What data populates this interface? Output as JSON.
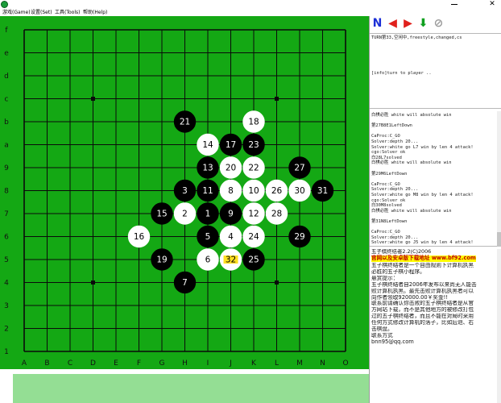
{
  "menu": {
    "items": [
      {
        "label": "游戏(Game)"
      },
      {
        "label": "设置(Set)"
      },
      {
        "label": "工具(Tools)"
      },
      {
        "label": "帮助(Help)"
      }
    ]
  },
  "window": {
    "close_glyph": "✕"
  },
  "board": {
    "size": 15,
    "row_labels": [
      "f",
      "e",
      "d",
      "c",
      "b",
      "a",
      "9",
      "8",
      "7",
      "6",
      "5",
      "4",
      "3",
      "2",
      "1"
    ],
    "col_labels": [
      "A",
      "B",
      "C",
      "D",
      "E",
      "F",
      "G",
      "H",
      "I",
      "J",
      "K",
      "L",
      "M",
      "N",
      "O"
    ],
    "colors": {
      "board": "#14a814",
      "grid": "#0a0a0a",
      "black_stone": "#000000",
      "white_stone": "#ffffff",
      "last_move": "#ffe020",
      "last_move_text": "#000000"
    },
    "stones": [
      {
        "n": "1",
        "col": "I",
        "row": "7",
        "color": "black"
      },
      {
        "n": "2",
        "col": "H",
        "row": "7",
        "color": "white"
      },
      {
        "n": "3",
        "col": "H",
        "row": "8",
        "color": "black"
      },
      {
        "n": "4",
        "col": "J",
        "row": "6",
        "color": "white"
      },
      {
        "n": "5",
        "col": "I",
        "row": "6",
        "color": "black"
      },
      {
        "n": "6",
        "col": "I",
        "row": "5",
        "color": "white"
      },
      {
        "n": "7",
        "col": "H",
        "row": "4",
        "color": "black"
      },
      {
        "n": "8",
        "col": "J",
        "row": "8",
        "color": "white"
      },
      {
        "n": "9",
        "col": "J",
        "row": "7",
        "color": "black"
      },
      {
        "n": "10",
        "col": "K",
        "row": "8",
        "color": "white"
      },
      {
        "n": "11",
        "col": "I",
        "row": "8",
        "color": "black"
      },
      {
        "n": "12",
        "col": "K",
        "row": "7",
        "color": "white"
      },
      {
        "n": "13",
        "col": "I",
        "row": "9",
        "color": "black"
      },
      {
        "n": "14",
        "col": "I",
        "row": "a",
        "color": "white"
      },
      {
        "n": "15",
        "col": "G",
        "row": "7",
        "color": "black"
      },
      {
        "n": "16",
        "col": "F",
        "row": "6",
        "color": "white"
      },
      {
        "n": "17",
        "col": "J",
        "row": "a",
        "color": "black"
      },
      {
        "n": "18",
        "col": "K",
        "row": "b",
        "color": "white"
      },
      {
        "n": "19",
        "col": "G",
        "row": "5",
        "color": "black"
      },
      {
        "n": "20",
        "col": "J",
        "row": "9",
        "color": "white"
      },
      {
        "n": "21",
        "col": "H",
        "row": "b",
        "color": "black"
      },
      {
        "n": "22",
        "col": "K",
        "row": "9",
        "color": "white"
      },
      {
        "n": "23",
        "col": "K",
        "row": "a",
        "color": "black"
      },
      {
        "n": "24",
        "col": "K",
        "row": "6",
        "color": "white"
      },
      {
        "n": "25",
        "col": "K",
        "row": "5",
        "color": "black"
      },
      {
        "n": "26",
        "col": "L",
        "row": "8",
        "color": "white"
      },
      {
        "n": "27",
        "col": "M",
        "row": "9",
        "color": "black"
      },
      {
        "n": "28",
        "col": "L",
        "row": "7",
        "color": "white"
      },
      {
        "n": "29",
        "col": "M",
        "row": "6",
        "color": "black"
      },
      {
        "n": "30",
        "col": "M",
        "row": "8",
        "color": "white"
      },
      {
        "n": "31",
        "col": "N",
        "row": "8",
        "color": "black"
      },
      {
        "n": "32",
        "col": "J",
        "row": "5",
        "color": "last"
      }
    ],
    "star_points": [
      {
        "col": "D",
        "row": "c"
      },
      {
        "col": "L",
        "row": "c"
      },
      {
        "col": "D",
        "row": "4"
      },
      {
        "col": "L",
        "row": "4"
      }
    ]
  },
  "toolbar": {
    "new_label": "N",
    "buttons": [
      {
        "name": "new-game-button",
        "glyph": "N",
        "color": "#1b2fd6"
      },
      {
        "name": "back-button",
        "glyph": "◀",
        "color": "#e0201c"
      },
      {
        "name": "forward-button",
        "glyph": "▶",
        "color": "#e0201c"
      },
      {
        "name": "solve-button",
        "glyph": "⬇",
        "color": "#10a020"
      },
      {
        "name": "stop-button",
        "glyph": "⊘",
        "color": "#9a9a9a"
      }
    ]
  },
  "status": {
    "line1": "TURN第33,空闲中,freestyle,changed,cs",
    "line2": "[info]turn to player .."
  },
  "log": {
    "lines": [
      "白棋必胜 white will absolute win",
      "",
      "第27B8E1LeftDown",
      "",
      "CaProc:C_GO",
      "Solver:depth 20...",
      "Solver:white go L7 win by len 4 attack!",
      "cgo:Solver ok",
      "白28L7solved",
      "白棋必胜 white will absolute win",
      "",
      "第29M6LeftDown",
      "",
      "CaProc:C_GO",
      "Solver:depth 20...",
      "Solver:white go M8 win by len 4 attack!",
      "cgo:Solver ok",
      "白30M8solved",
      "白棋必胜 white will absolute win",
      "",
      "第31N8LeftDown",
      "",
      "CaProc:C_GO",
      "Solver:depth 20...",
      "Solver:white go J5 win by len 4 attack!",
      "cgo:Solver ok",
      "白32J5solved",
      "白棋必胜 white will absolute win"
    ]
  },
  "info": {
    "title": "五子棋终结者2.2(C)2006",
    "ad": "官网以及安卓版下载地址 www.bf92.com",
    "lines": [
      "五子棋终结者是一个自由规则下计算机执黑",
      "必胜的五子棋小程序。",
      "悬赏提示：",
      "五子棋终结者自2006年发布以来尚无人能击",
      "败计算机执黑。最先击败计算机执黑者可以",
      "向作者领取920000.00￥奖金!!",
      "联系前请确认你击败的五子棋终结者是从官",
      "方网站下载，而不是其他地方的被修改打包",
      "过的五子棋终结者，而且不能在对局时采用",
      "任何方式修改计算机的落子，比如后退、右",
      "击棋盘。",
      "联系方式",
      "bnn95@qq.com"
    ]
  }
}
